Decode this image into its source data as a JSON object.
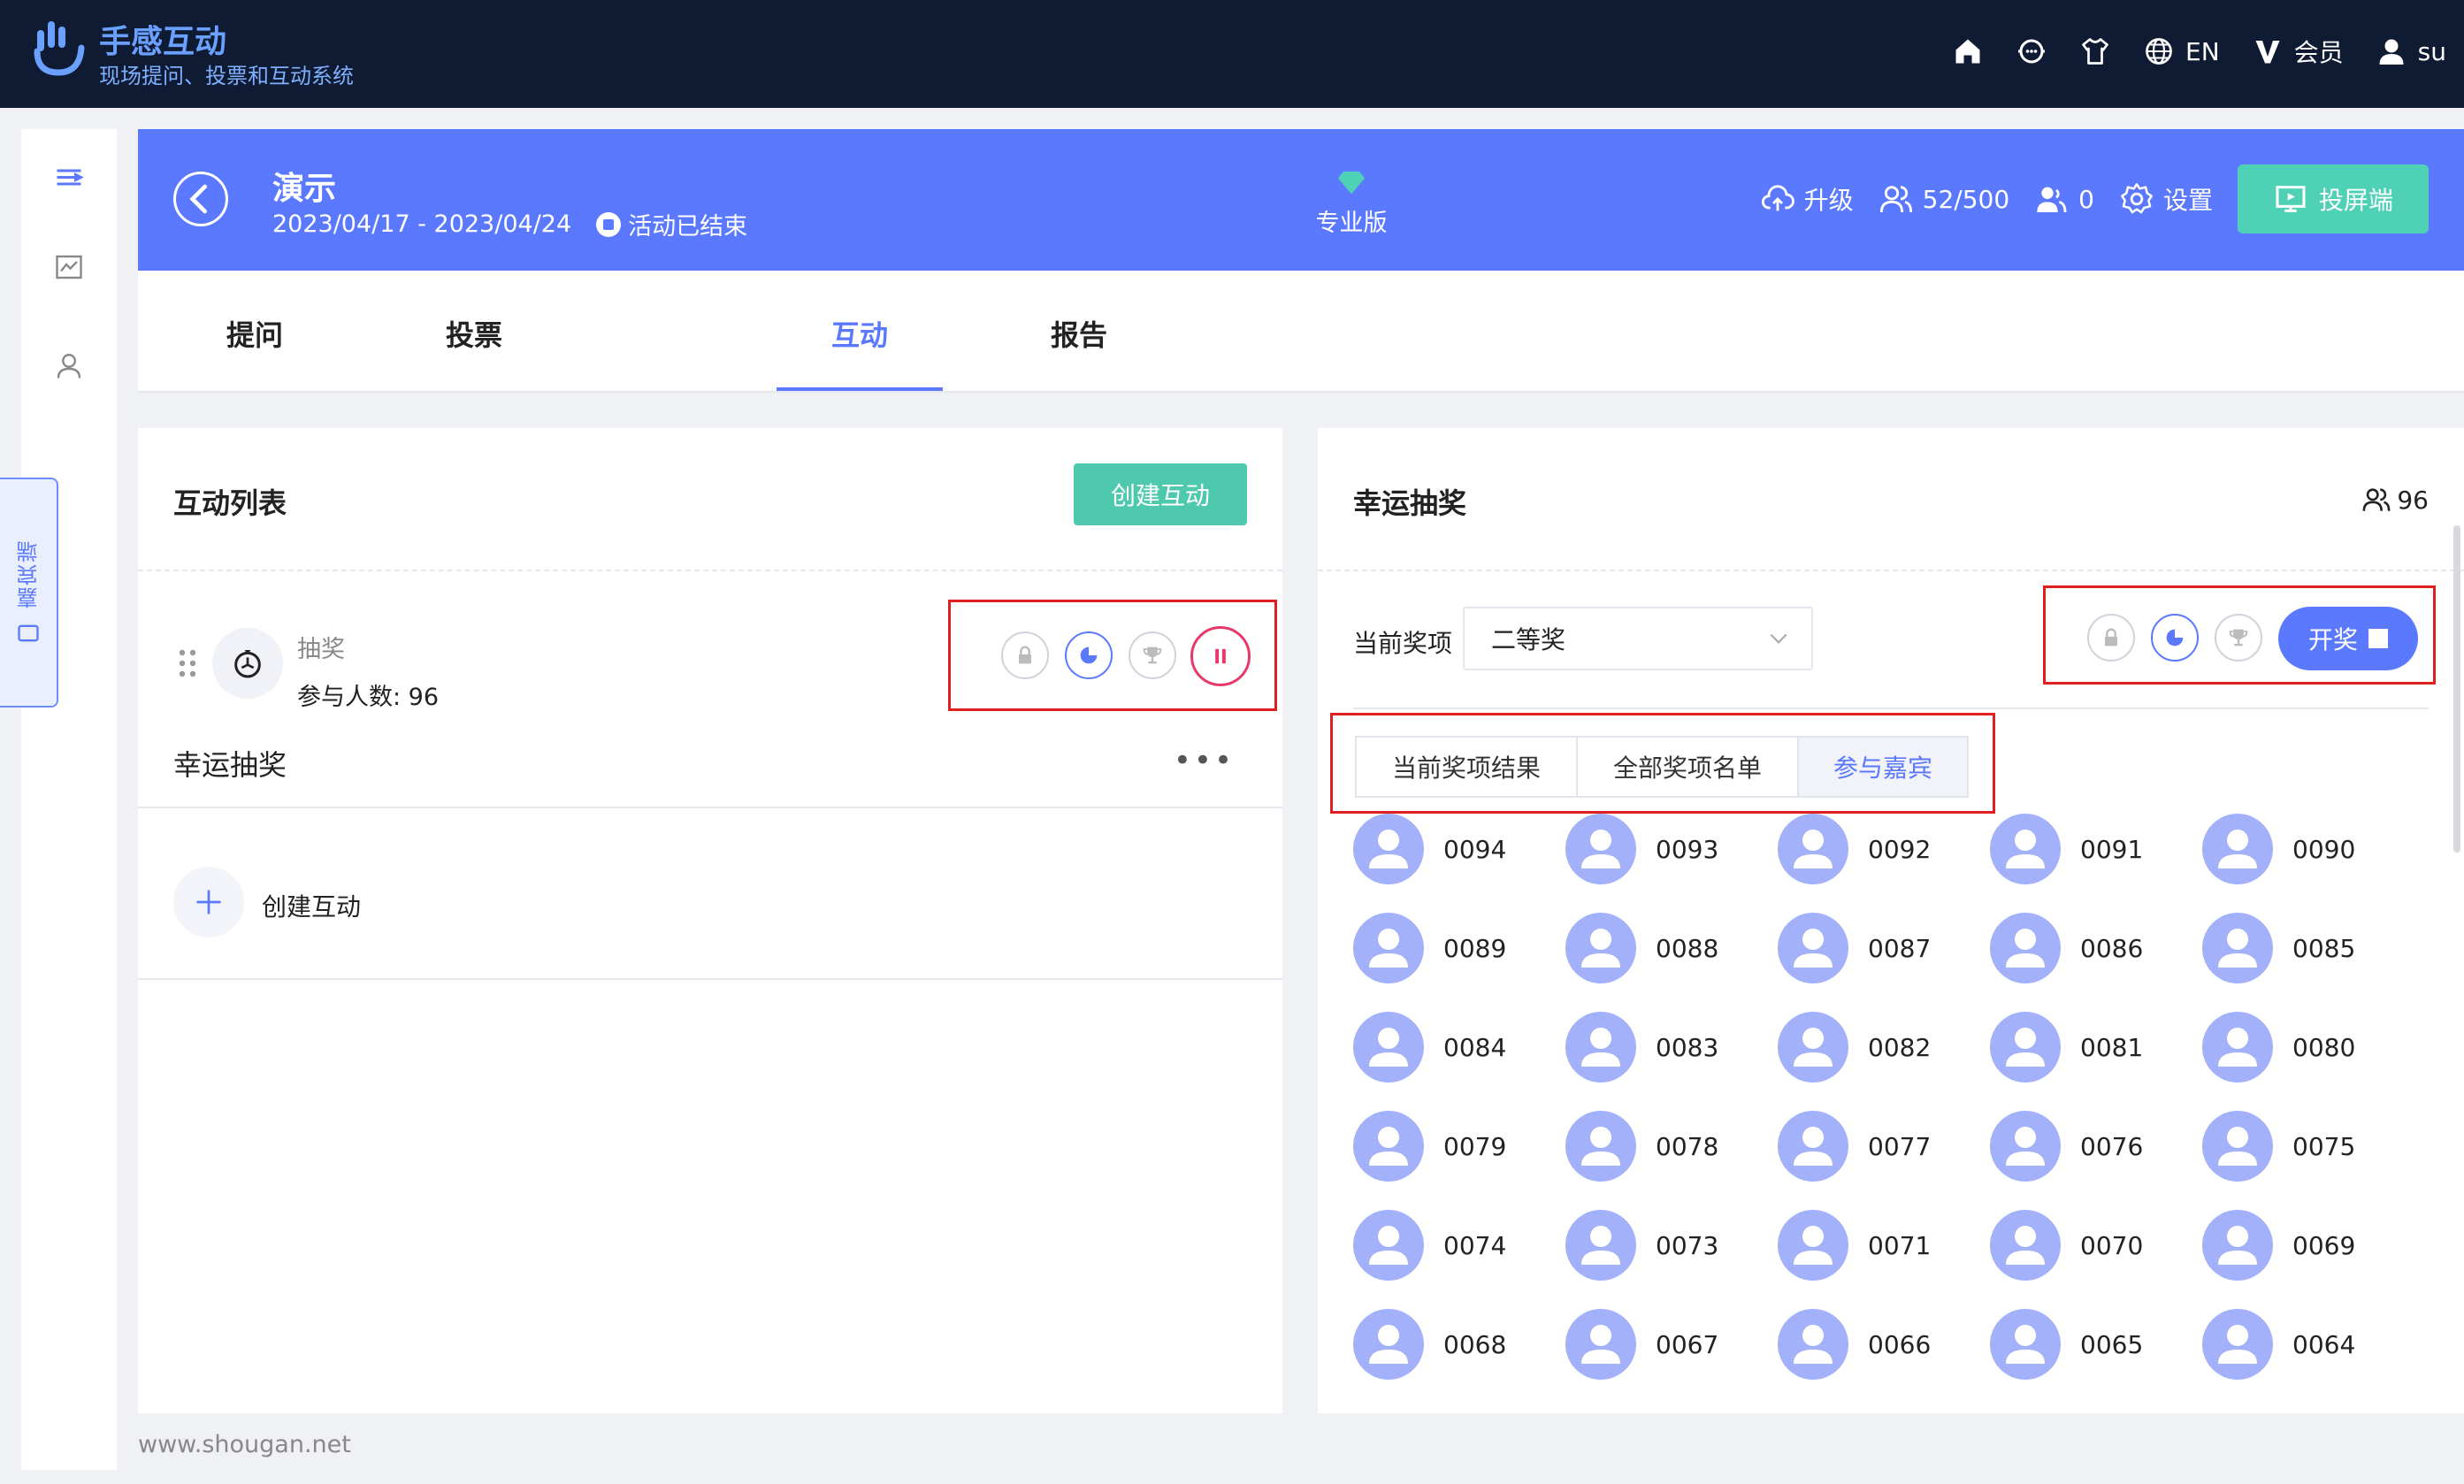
{
  "brand": {
    "name": "手感互动",
    "subtitle": "现场提问、投票和互动系统",
    "logo_icon": "hand-logo-icon"
  },
  "topnav": {
    "items": [
      {
        "icon": "home-icon",
        "label": ""
      },
      {
        "icon": "chat-support-icon",
        "label": ""
      },
      {
        "icon": "shirt-icon",
        "label": ""
      },
      {
        "icon": "globe-icon",
        "label": "EN"
      },
      {
        "icon": "vip-v-icon",
        "label": "会员"
      },
      {
        "icon": "user-icon",
        "label": "su"
      }
    ]
  },
  "sidebar": {
    "items": [
      {
        "icon": "menu-list-icon"
      },
      {
        "icon": "chart-icon"
      },
      {
        "icon": "person-icon"
      }
    ],
    "guest_tab": {
      "label": "嘉宾端",
      "icon": "tablet-icon"
    }
  },
  "event": {
    "title": "演示",
    "dates": "2023/04/17 - 2023/04/24",
    "status": "活动已结束",
    "edition": "专业版",
    "edition_icon": "diamond-icon",
    "actions": {
      "upgrade": "升级",
      "participants": "52/500",
      "online": "0",
      "settings": "设置",
      "screen": "投屏端"
    }
  },
  "tabs": {
    "items": [
      {
        "label": "提问"
      },
      {
        "label": "投票"
      },
      {
        "label": "互动"
      },
      {
        "label": "报告"
      }
    ],
    "active_index": 2
  },
  "interaction_list": {
    "title": "互动列表",
    "create_button": "创建互动",
    "item": {
      "type": "抽奖",
      "participants": "参与人数: 96",
      "name": "幸运抽奖",
      "more": "•••"
    },
    "add_label": "创建互动"
  },
  "lottery": {
    "title": "幸运抽奖",
    "count": "96",
    "prize_label": "当前奖项",
    "prize_selected": "二等奖",
    "draw_button": "开奖",
    "segments": [
      {
        "label": "当前奖项结果"
      },
      {
        "label": "全部奖项名单"
      },
      {
        "label": "参与嘉宾"
      }
    ],
    "active_segment": 2,
    "guests": [
      "0094",
      "0093",
      "0092",
      "0091",
      "0090",
      "0089",
      "0088",
      "0087",
      "0086",
      "0085",
      "0084",
      "0083",
      "0082",
      "0081",
      "0080",
      "0079",
      "0078",
      "0077",
      "0076",
      "0075",
      "0074",
      "0073",
      "0071",
      "0070",
      "0069",
      "0068",
      "0067",
      "0066",
      "0065",
      "0064"
    ]
  },
  "footer": {
    "text": "www.shougan.net"
  },
  "colors": {
    "primary": "#5b79ff",
    "navy": "#0f1a33",
    "teal": "#4fc9ad",
    "pause": "#e8386a",
    "highlight_box": "#e02020",
    "avatar": "#a3b1fb"
  }
}
